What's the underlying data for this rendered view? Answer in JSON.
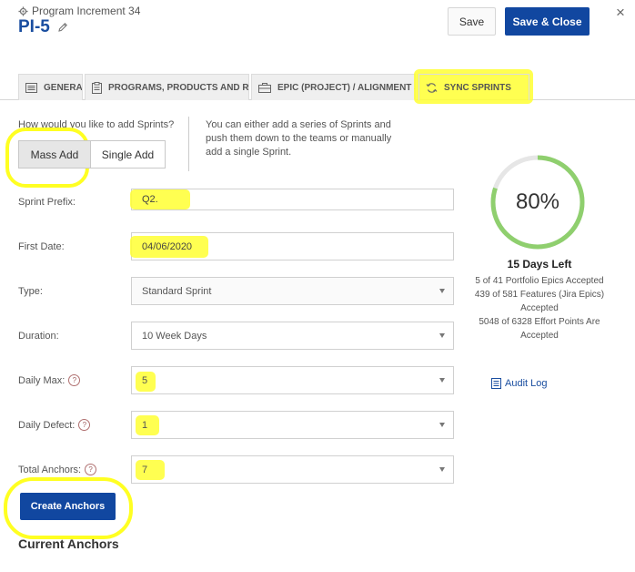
{
  "header": {
    "breadcrumb": "Program Increment 34",
    "title": "PI-5",
    "save_label": "Save",
    "save_close_label": "Save & Close",
    "close_glyph": "×"
  },
  "tabs": [
    {
      "label": "GENERAL",
      "icon": "list-icon"
    },
    {
      "label": "PROGRAMS, PRODUCTS AND R...",
      "icon": "clipboard-icon"
    },
    {
      "label": "EPIC (PROJECT) / ALIGNMENT S...",
      "icon": "briefcase-icon"
    },
    {
      "label": "SYNC SPRINTS",
      "icon": "sync-icon",
      "active": true
    }
  ],
  "mass_add": {
    "question": "How would you like to add Sprints?",
    "mass_label": "Mass Add",
    "single_label": "Single Add",
    "help": "You can either add a series of Sprints and push them down to the teams or manually add a single Sprint."
  },
  "form": {
    "sprint_prefix": {
      "label": "Sprint Prefix:",
      "value": "Q2."
    },
    "first_date": {
      "label": "First Date:",
      "value": "04/06/2020"
    },
    "type": {
      "label": "Type:",
      "value": "Standard Sprint"
    },
    "duration": {
      "label": "Duration:",
      "value": "10 Week Days"
    },
    "daily_max": {
      "label": "Daily Max:",
      "value": "5"
    },
    "daily_defect": {
      "label": "Daily Defect:",
      "value": "1"
    },
    "total_anchors": {
      "label": "Total Anchors:",
      "value": "7"
    },
    "help_glyph": "?"
  },
  "create_label": "Create Anchors",
  "current_anchors": "Current Anchors",
  "progress": {
    "percent": 80,
    "percent_label": "80%",
    "days_left": "15 Days Left",
    "epics": "5 of 41 Portfolio Epics Accepted",
    "features": "439 of 581  Features (Jira Epics) Accepted",
    "effort": "5048 of 6328 Effort Points Are Accepted"
  },
  "audit_log": "Audit Log",
  "colors": {
    "primary": "#1147a0",
    "title": "#1a4ea0",
    "progress": "#8fcf6e",
    "track": "#e6e6e6",
    "highlight": "#ffff33"
  }
}
